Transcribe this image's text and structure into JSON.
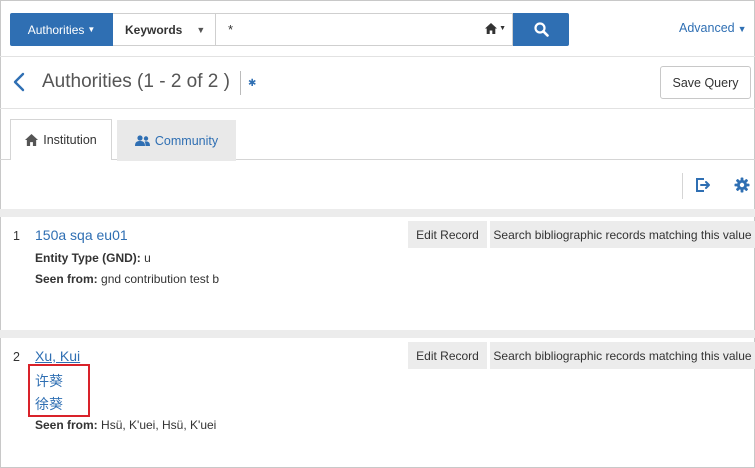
{
  "search": {
    "scope_label": "Authorities",
    "type_label": "Keywords",
    "query_value": "*"
  },
  "advanced_label": "Advanced",
  "header": {
    "title": "Authorities (1 - 2 of 2 )",
    "save_query_label": "Save Query"
  },
  "tabs": [
    {
      "label": "Institution",
      "icon": "home-icon",
      "active": true
    },
    {
      "label": "Community",
      "icon": "users-icon",
      "active": false
    }
  ],
  "records": [
    {
      "number": "1",
      "title": "150a sqa eu01",
      "entity_type_label": "Entity Type (GND):",
      "entity_type_value": "u",
      "seen_from_label": "Seen from:",
      "seen_from_value": "gnd contribution test b",
      "edit_label": "Edit Record",
      "search_label": "Search bibliographic records matching this value"
    },
    {
      "number": "2",
      "title": "Xu, Kui",
      "alt_names": [
        "许葵",
        "徐葵"
      ],
      "seen_from_label": "Seen from:",
      "seen_from_value": "Hsü, K'uei, Hsü, K'uei",
      "edit_label": "Edit Record",
      "search_label": "Search bibliographic records matching this value"
    }
  ],
  "colors": {
    "primary": "#2f6fb3",
    "highlight": "#d9222a"
  }
}
